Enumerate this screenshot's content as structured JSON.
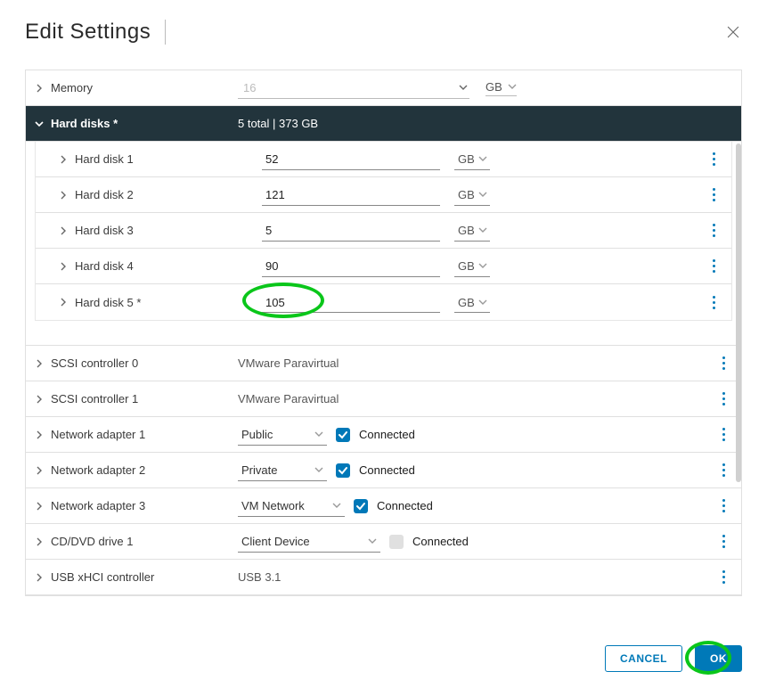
{
  "dialog": {
    "title": "Edit Settings"
  },
  "memory": {
    "label": "Memory",
    "value": "16",
    "unit": "GB"
  },
  "hardDisks": {
    "header": "Hard disks *",
    "summary": "5 total | 373 GB",
    "items": [
      {
        "label": "Hard disk 1",
        "value": "52",
        "unit": "GB"
      },
      {
        "label": "Hard disk 2",
        "value": "121",
        "unit": "GB"
      },
      {
        "label": "Hard disk 3",
        "value": "5",
        "unit": "GB"
      },
      {
        "label": "Hard disk 4",
        "value": "90",
        "unit": "GB"
      },
      {
        "label": "Hard disk 5 *",
        "value": "105",
        "unit": "GB"
      }
    ]
  },
  "scsi": [
    {
      "label": "SCSI controller 0",
      "value": "VMware Paravirtual"
    },
    {
      "label": "SCSI controller 1",
      "value": "VMware Paravirtual"
    }
  ],
  "networks": [
    {
      "label": "Network adapter 1",
      "value": "Public",
      "connectedLabel": "Connected",
      "connected": true
    },
    {
      "label": "Network adapter 2",
      "value": "Private",
      "connectedLabel": "Connected",
      "connected": true
    },
    {
      "label": "Network adapter 3",
      "value": "VM Network",
      "connectedLabel": "Connected",
      "connected": true
    }
  ],
  "cddvd": {
    "label": "CD/DVD drive 1",
    "value": "Client Device",
    "connectedLabel": "Connected",
    "connected": false
  },
  "usb": {
    "label": "USB xHCI controller",
    "value": "USB 3.1"
  },
  "footer": {
    "cancel": "CANCEL",
    "ok": "OK"
  }
}
